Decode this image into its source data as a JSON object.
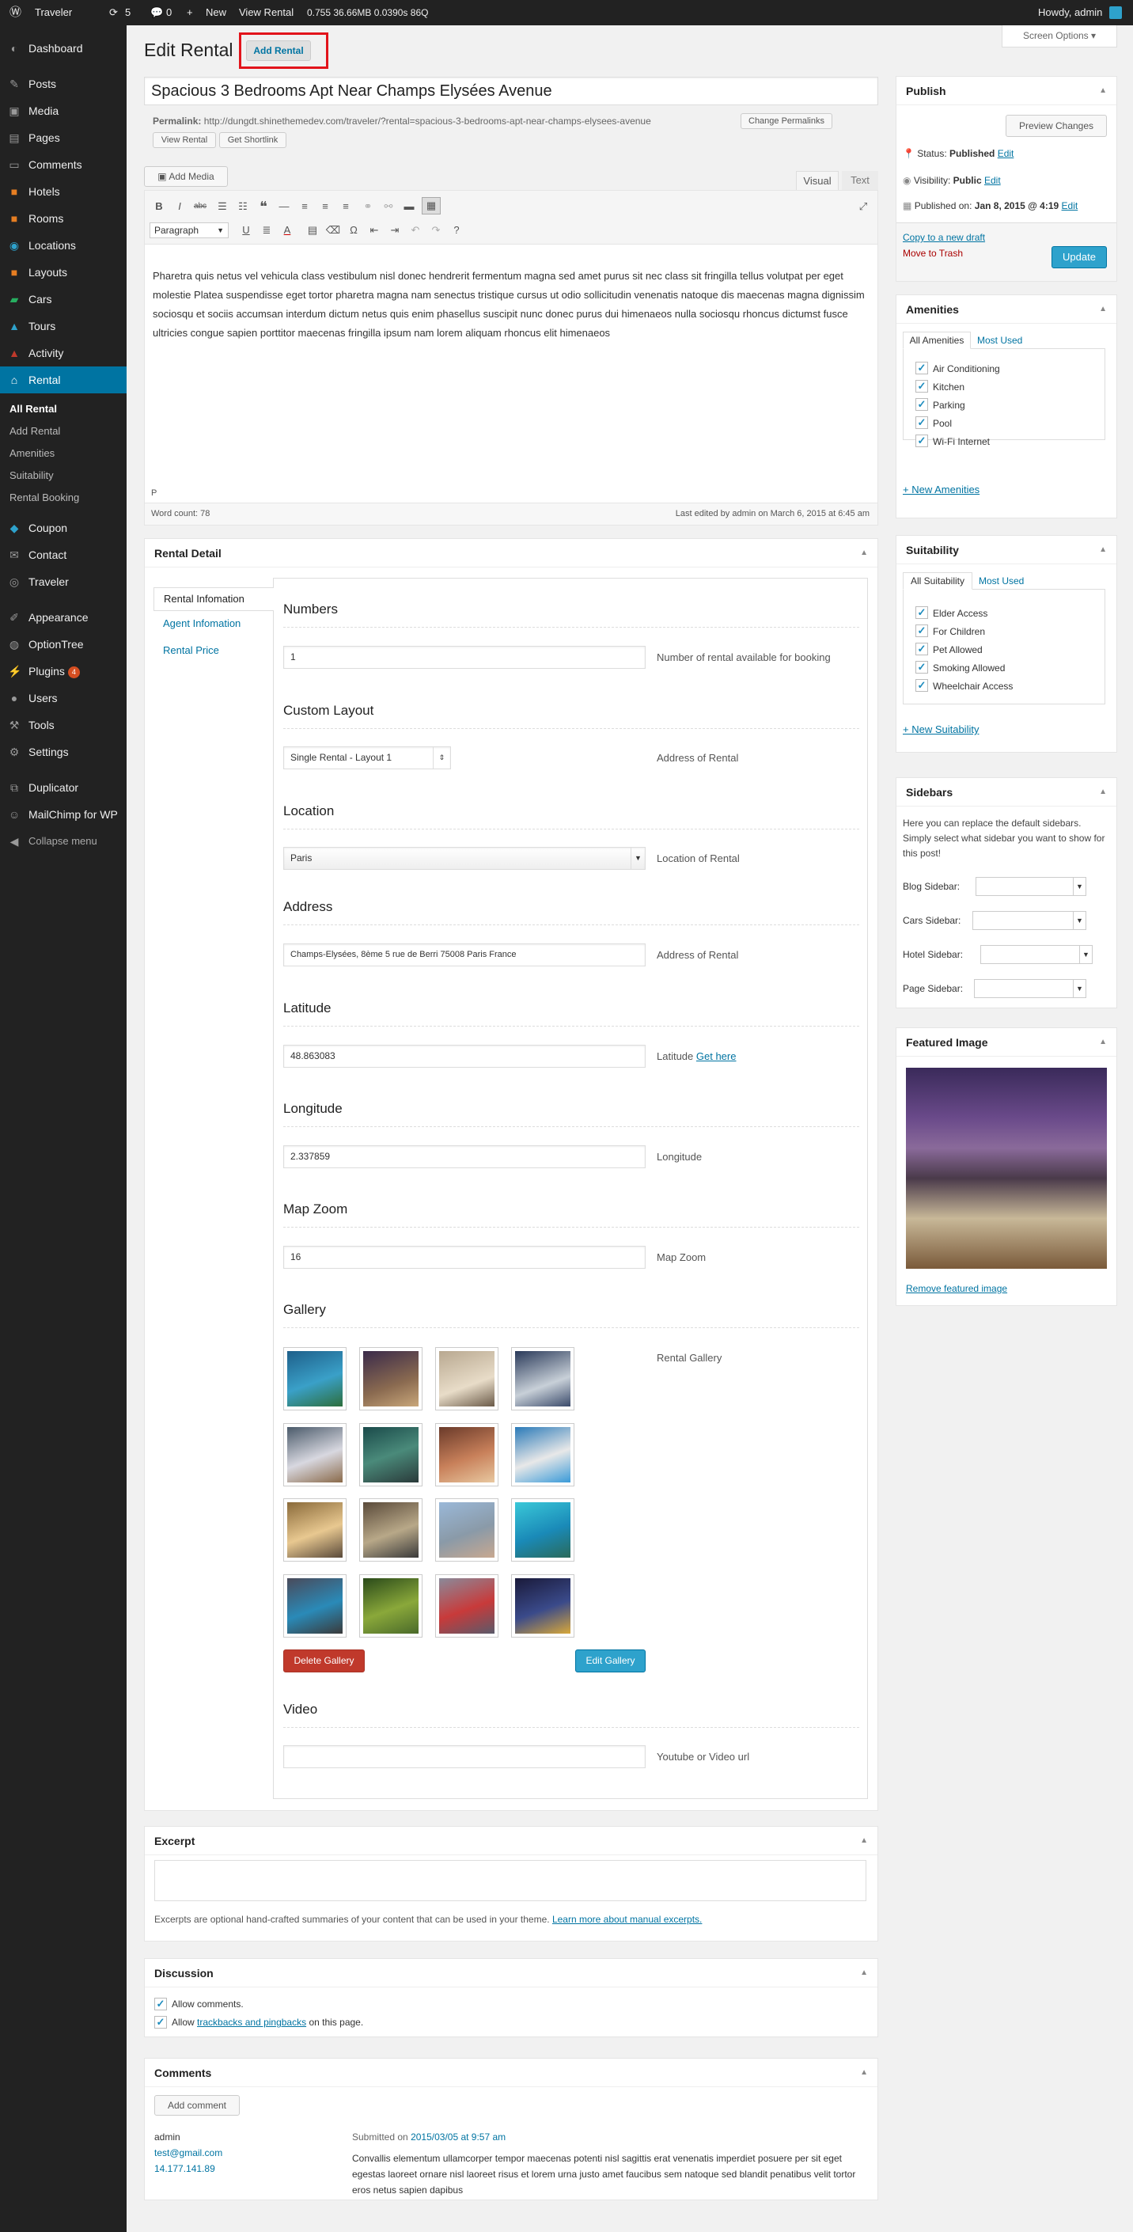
{
  "adminbar": {
    "site": "Traveler",
    "updates": "5",
    "comments": "0",
    "new": "New",
    "view": "View Rental",
    "stats": "0.755  36.66MB  0.0390s  86Q",
    "howdy": "Howdy, admin"
  },
  "sidebar": {
    "items": [
      {
        "label": "Dashboard",
        "icon": "dashboard-icon"
      },
      {
        "label": "Posts",
        "icon": "pin-icon"
      },
      {
        "label": "Media",
        "icon": "media-icon"
      },
      {
        "label": "Pages",
        "icon": "page-icon"
      },
      {
        "label": "Comments",
        "icon": "comment-icon"
      },
      {
        "label": "Hotels",
        "icon": "hotel-icon"
      },
      {
        "label": "Rooms",
        "icon": "room-icon"
      },
      {
        "label": "Locations",
        "icon": "location-icon"
      },
      {
        "label": "Layouts",
        "icon": "layout-icon"
      },
      {
        "label": "Cars",
        "icon": "car-icon"
      },
      {
        "label": "Tours",
        "icon": "tour-icon"
      },
      {
        "label": "Activity",
        "icon": "activity-icon"
      },
      {
        "label": "Rental",
        "icon": "rental-icon"
      },
      {
        "label": "Coupon",
        "icon": "coupon-icon"
      },
      {
        "label": "Contact",
        "icon": "contact-icon"
      },
      {
        "label": "Traveler",
        "icon": "traveler-icon"
      },
      {
        "label": "Appearance",
        "icon": "brush-icon"
      },
      {
        "label": "OptionTree",
        "icon": "tree-icon"
      },
      {
        "label": "Plugins",
        "icon": "plug-icon",
        "badge": "4"
      },
      {
        "label": "Users",
        "icon": "user-icon"
      },
      {
        "label": "Tools",
        "icon": "wrench-icon"
      },
      {
        "label": "Settings",
        "icon": "settings-icon"
      },
      {
        "label": "Duplicator",
        "icon": "duplicator-icon"
      },
      {
        "label": "MailChimp for WP",
        "icon": "mailchimp-icon"
      },
      {
        "label": "Collapse menu",
        "icon": "collapse-icon"
      }
    ],
    "submenu": [
      "All Rental",
      "Add Rental",
      "Amenities",
      "Suitability",
      "Rental Booking"
    ]
  },
  "header": {
    "title": "Edit Rental",
    "add": "Add Rental",
    "screen_options": "Screen Options"
  },
  "post": {
    "title": "Spacious 3 Bedrooms Apt Near Champs Elysées Avenue",
    "permalink_label": "Permalink:",
    "permalink": "http://dungdt.shinethemedev.com/traveler/?rental=spacious-3-bedrooms-apt-near-champs-elysees-avenue",
    "change_permalinks": "Change Permalinks",
    "view_rental": "View Rental",
    "shortlink": "Get Shortlink"
  },
  "editor": {
    "add_media": "Add Media",
    "tab_visual": "Visual",
    "tab_text": "Text",
    "format": "Paragraph",
    "content": "Pharetra quis netus vel vehicula class vestibulum nisl donec hendrerit fermentum magna sed amet purus sit nec class sit fringilla tellus volutpat per eget molestie Platea suspendisse eget tortor pharetra magna nam senectus tristique cursus ut odio sollicitudin venenatis natoque dis maecenas magna dignissim sociosqu et sociis accumsan interdum dictum netus quis enim phasellus suscipit nunc donec purus dui himenaeos nulla sociosqu rhoncus dictumst fusce ultricies congue sapien porttitor maecenas fringilla ipsum nam lorem aliquam rhoncus elit himenaeos",
    "path": "P",
    "wordcount": "Word count: 78",
    "lastedit": "Last edited by admin on March 6, 2015 at 6:45 am"
  },
  "rental_detail": {
    "title": "Rental Detail",
    "tabs": [
      "Rental Infomation",
      "Agent Infomation",
      "Rental Price"
    ],
    "numbers": {
      "heading": "Numbers",
      "value": "1",
      "desc": "Number of rental available for booking"
    },
    "layout": {
      "heading": "Custom Layout",
      "value": "Single Rental - Layout 1",
      "desc": "Address of Rental"
    },
    "location": {
      "heading": "Location",
      "value": "Paris",
      "desc": "Location of Rental"
    },
    "address": {
      "heading": "Address",
      "value": "Champs-Elysées, 8ème 5 rue de Berri 75008 Paris France",
      "desc": "Address of Rental"
    },
    "latitude": {
      "heading": "Latitude",
      "value": "48.863083",
      "desc": "Latitude",
      "link": "Get here"
    },
    "longitude": {
      "heading": "Longitude",
      "value": "2.337859",
      "desc": "Longitude"
    },
    "zoom": {
      "heading": "Map Zoom",
      "value": "16",
      "desc": "Map Zoom"
    },
    "gallery": {
      "heading": "Gallery",
      "desc": "Rental Gallery",
      "delete": "Delete Gallery",
      "edit": "Edit Gallery"
    },
    "video": {
      "heading": "Video",
      "value": "",
      "desc": "Youtube or Video url"
    }
  },
  "excerpt": {
    "title": "Excerpt",
    "help": "Excerpts are optional hand-crafted summaries of your content that can be used in your theme.",
    "link": "Learn more about manual excerpts."
  },
  "discussion": {
    "title": "Discussion",
    "allow_comments": "Allow comments.",
    "allow_pre": "Allow",
    "allow_link": "trackbacks and pingbacks",
    "allow_post": "on this page."
  },
  "comments": {
    "title": "Comments",
    "add": "Add comment",
    "author": "admin",
    "email": "test@gmail.com",
    "ip": "14.177.141.89",
    "submitted": "Submitted on",
    "date": "2015/03/05 at 9:57 am",
    "text": "Convallis elementum ullamcorper tempor maecenas potenti nisl sagittis erat venenatis imperdiet posuere per sit eget egestas laoreet ornare nisl laoreet risus et lorem urna justo amet faucibus sem natoque sed blandit penatibus velit tortor eros netus sapien dapibus"
  },
  "publish": {
    "title": "Publish",
    "preview": "Preview Changes",
    "status_label": "Status:",
    "status": "Published",
    "visibility_label": "Visibility:",
    "visibility": "Public",
    "published_label": "Published on:",
    "published": "Jan 8, 2015 @ 4:19",
    "edit": "Edit",
    "copy": "Copy to a new draft",
    "trash": "Move to Trash",
    "update": "Update"
  },
  "amenities": {
    "title": "Amenities",
    "tab_all": "All Amenities",
    "tab_used": "Most Used",
    "items": [
      "Air Conditioning",
      "Kitchen",
      "Parking",
      "Pool",
      "Wi-Fi Internet"
    ],
    "add": "+ New Amenities"
  },
  "suitability": {
    "title": "Suitability",
    "tab_all": "All Suitability",
    "tab_used": "Most Used",
    "items": [
      "Elder Access",
      "For Children",
      "Pet Allowed",
      "Smoking Allowed",
      "Wheelchair Access"
    ],
    "add": "+ New Suitability"
  },
  "sidebars": {
    "title": "Sidebars",
    "help": "Here you can replace the default sidebars. Simply select what sidebar you want to show for this post!",
    "fields": [
      "Blog Sidebar:",
      "Cars Sidebar:",
      "Hotel Sidebar:",
      "Page Sidebar:"
    ]
  },
  "featured": {
    "title": "Featured Image",
    "remove": "Remove featured image"
  },
  "colors": {
    "accent": "#0074a2",
    "sidebar": "#222222",
    "update": "#2ea2cc",
    "delete": "#c0392b",
    "edit_gallery": "#2ea2cc",
    "highlight": "#e2141b"
  }
}
